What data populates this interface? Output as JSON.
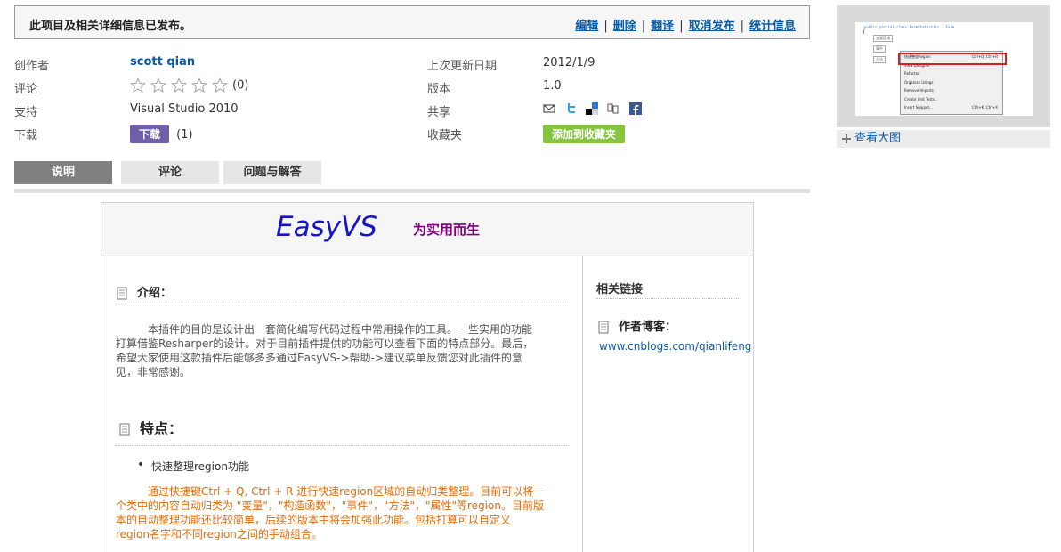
{
  "notice": {
    "message": "此项目及相关详细信息已发布。",
    "links": [
      "编辑",
      "删除",
      "翻译",
      "取消发布",
      "统计信息"
    ],
    "separator": "|"
  },
  "info": {
    "creator_label": "创作者",
    "creator": "scott qian",
    "rating_label": "评论",
    "rating_count": "(0)",
    "rating_stars_filled": 0,
    "rating_stars_total": 5,
    "support_label": "支持",
    "support": "Visual Studio 2010",
    "download_label": "下载",
    "download_button": "下载",
    "download_count": "(1)",
    "updated_label": "上次更新日期",
    "updated": "2012/1/9",
    "version_label": "版本",
    "version": "1.0",
    "share_label": "共享",
    "share_icons": [
      "email-icon",
      "twitter-icon",
      "delicious-icon",
      "digg-icon",
      "facebook-icon"
    ],
    "favorites_label": "收藏夹",
    "favorites_button": "添加到收藏夹"
  },
  "tabs": [
    {
      "label": "说明",
      "active": true
    },
    {
      "label": "评论",
      "active": false
    },
    {
      "label": "问题与解答",
      "active": false
    }
  ],
  "description": {
    "brand": "EasyVS",
    "slogan": "为实用而生",
    "intro_title": "介绍：",
    "intro_lines": [
      "本插件的目的是设计出一套简化编写代码过程中常用操作的工具。一些实用的功能",
      "打算借鉴Resharper的设计。对于目前插件提供的功能可以查看下面的特点部分。最后，",
      "希望大家使用这款插件后能够多多通过EasyVS->帮助->建议菜单反馈您对此插件的意",
      "见，非常感谢。"
    ],
    "features_title": "特点：",
    "feature_bullet": "快速整理region功能",
    "feature_lines": [
      "通过快捷键Ctrl + Q, Ctrl + R 进行快速region区域的自动归类整理。目前可以将一",
      "个类中的内容自动归类为 \"变量\"，\"构造函数\"，\"事件\"，\"方法\"，\"属性\"等region。目前版",
      "本的自动整理功能还比较简单，后续的版本中将会加强此功能。包括打算可以自定义",
      "region名字和不同region之间的手动组合。"
    ],
    "related_title": "相关链接",
    "author_blog_label": "作者博客：",
    "author_blog_link": "www.cnblogs.com/qianlifeng"
  },
  "thumbnail": {
    "view_larger": "查看大图",
    "code_line": "public partial class FormStatistics : Form",
    "region_labels": [
      "变量区域",
      "事件",
      "方法"
    ],
    "menu": [
      {
        "label": "快速整理Region",
        "shortcut": "Ctrl+Q, Ctrl+R",
        "highlighted": true
      },
      {
        "label": "View Designer",
        "shortcut": ""
      },
      {
        "label": "Refactor",
        "shortcut": ""
      },
      {
        "label": "Organize Usings",
        "shortcut": ""
      },
      {
        "label": "Remove Imports",
        "shortcut": ""
      },
      {
        "label": "Create Unit Tests...",
        "shortcut": ""
      },
      {
        "label": "Insert Snippet...",
        "shortcut": "Ctrl+K, Ctrl+X"
      }
    ]
  },
  "colors": {
    "link": "#0a5aa5",
    "download_button": "#6f5ea8",
    "favorites_button": "#86c440",
    "brand": "#1414c8",
    "slogan": "#800080",
    "feature_text": "#e36c09"
  }
}
